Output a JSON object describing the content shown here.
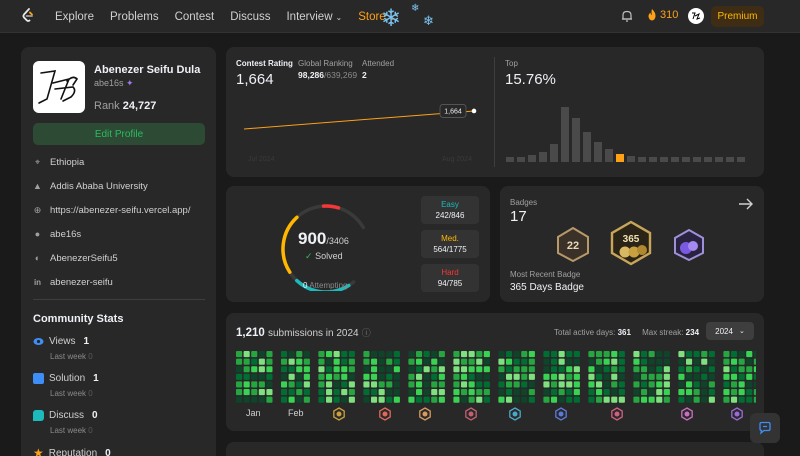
{
  "nav": {
    "items": [
      {
        "label": "Explore",
        "name": "nav-explore"
      },
      {
        "label": "Problems",
        "name": "nav-problems"
      },
      {
        "label": "Contest",
        "name": "nav-contest"
      },
      {
        "label": "Discuss",
        "name": "nav-discuss"
      },
      {
        "label": "Interview",
        "name": "nav-interview"
      },
      {
        "label": "Store",
        "name": "nav-store"
      }
    ],
    "streak": "310",
    "premium": "Premium",
    "avatar_text": "AB"
  },
  "profile": {
    "name": "Abenezer Seifu Dula",
    "username": "abe16s",
    "rank_label": "Rank",
    "rank": "24,727",
    "edit_label": "Edit Profile",
    "location": "Ethiopia",
    "school": "Addis Ababa University",
    "website": "https://abenezer-seifu.vercel.app/",
    "github": "abe16s",
    "twitter": "AbenezerSeifu5",
    "linkedin": "abenezer-seifu"
  },
  "community": {
    "title": "Community Stats",
    "views_label": "Views",
    "views": "1",
    "views_sub": "Last week",
    "views_sub_val": "0",
    "solution_label": "Solution",
    "solution": "1",
    "solution_sub": "Last week",
    "solution_sub_val": "0",
    "discuss_label": "Discuss",
    "discuss": "0",
    "discuss_sub": "Last week",
    "discuss_sub_val": "0",
    "rep_label": "Reputation",
    "rep": "0"
  },
  "contest": {
    "rating_label": "Contest Rating",
    "rating": "1,664",
    "global_label": "Global Ranking",
    "global": "98,286",
    "global_total": "/639,269",
    "attended_label": "Attended",
    "attended": "2",
    "tooltip": "1,664",
    "top_label": "Top",
    "top": "15.76%",
    "x_start": "Jul 2024",
    "x_end": "Aug 2024"
  },
  "chart_data": {
    "type": "line",
    "x": [
      "Jul 2024",
      "Aug 2024"
    ],
    "series": [
      {
        "values": [
          1500,
          1664
        ]
      }
    ],
    "xlabel": "",
    "ylabel": ""
  },
  "solved": {
    "count": "900",
    "total": "/3406",
    "solved_label": "Solved",
    "attempting": "0",
    "attempting_label": "Attempting",
    "easy_label": "Easy",
    "easy": "242/846",
    "med_label": "Med.",
    "med": "564/1775",
    "hard_label": "Hard",
    "hard": "94/785",
    "easy_frac": 0.286,
    "med_frac": 0.318,
    "hard_frac": 0.12
  },
  "badges": {
    "label": "Badges",
    "count": "17",
    "recent_label": "Most Recent Badge",
    "recent": "365 Days Badge"
  },
  "submissions": {
    "count": "1,210",
    "suffix": "submissions in 2024",
    "active_label": "Total active days:",
    "active": "361",
    "streak_label": "Max streak:",
    "streak": "234",
    "year": "2024",
    "months": [
      "Jan",
      "Feb"
    ]
  },
  "colors": {
    "accent": "#ffa116",
    "easy": "#1cbaba",
    "med": "#ffb700",
    "hard": "#f63737",
    "green": "#2cbb5d"
  }
}
